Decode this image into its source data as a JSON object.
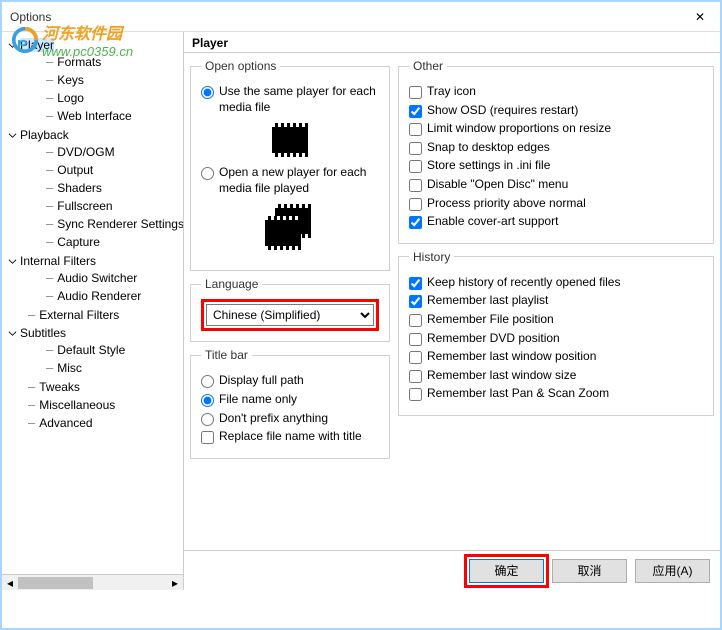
{
  "window": {
    "title": "Options",
    "close": "✕"
  },
  "watermark": {
    "line1": "河东软件园",
    "line2": "www.pc0359.cn"
  },
  "panel_title": "Player",
  "tree": {
    "player": {
      "label": "Player",
      "formats": "Formats",
      "keys": "Keys",
      "logo": "Logo",
      "web": "Web Interface"
    },
    "playback": {
      "label": "Playback",
      "dvd": "DVD/OGM",
      "output": "Output",
      "shaders": "Shaders",
      "fullscreen": "Fullscreen",
      "sync": "Sync Renderer Settings",
      "capture": "Capture"
    },
    "internal": {
      "label": "Internal Filters",
      "switcher": "Audio Switcher",
      "renderer": "Audio Renderer"
    },
    "external": "External Filters",
    "subtitles": {
      "label": "Subtitles",
      "default": "Default Style",
      "misc": "Misc"
    },
    "tweaks": "Tweaks",
    "misc": "Miscellaneous",
    "advanced": "Advanced"
  },
  "open_options": {
    "legend": "Open options",
    "same": "Use the same player for each media file",
    "new": "Open a new player for each media file played"
  },
  "language": {
    "legend": "Language",
    "value": "Chinese (Simplified)"
  },
  "titlebar_opts": {
    "legend": "Title bar",
    "full": "Display full path",
    "filename": "File name only",
    "noprefix": "Don't prefix anything",
    "replace": "Replace file name with title"
  },
  "other": {
    "legend": "Other",
    "tray": "Tray icon",
    "osd": "Show OSD (requires restart)",
    "limit": "Limit window proportions on resize",
    "snap": "Snap to desktop edges",
    "ini": "Store settings in .ini file",
    "disable_open": "Disable \"Open Disc\" menu",
    "priority": "Process priority above normal",
    "cover": "Enable cover-art support"
  },
  "history": {
    "legend": "History",
    "keep": "Keep history of recently opened files",
    "playlist": "Remember last playlist",
    "filepos": "Remember File position",
    "dvdpos": "Remember DVD position",
    "winpos": "Remember last window position",
    "winsize": "Remember last window size",
    "panzoom": "Remember last Pan & Scan Zoom"
  },
  "buttons": {
    "ok": "确定",
    "cancel": "取消",
    "apply": "应用(A)"
  }
}
